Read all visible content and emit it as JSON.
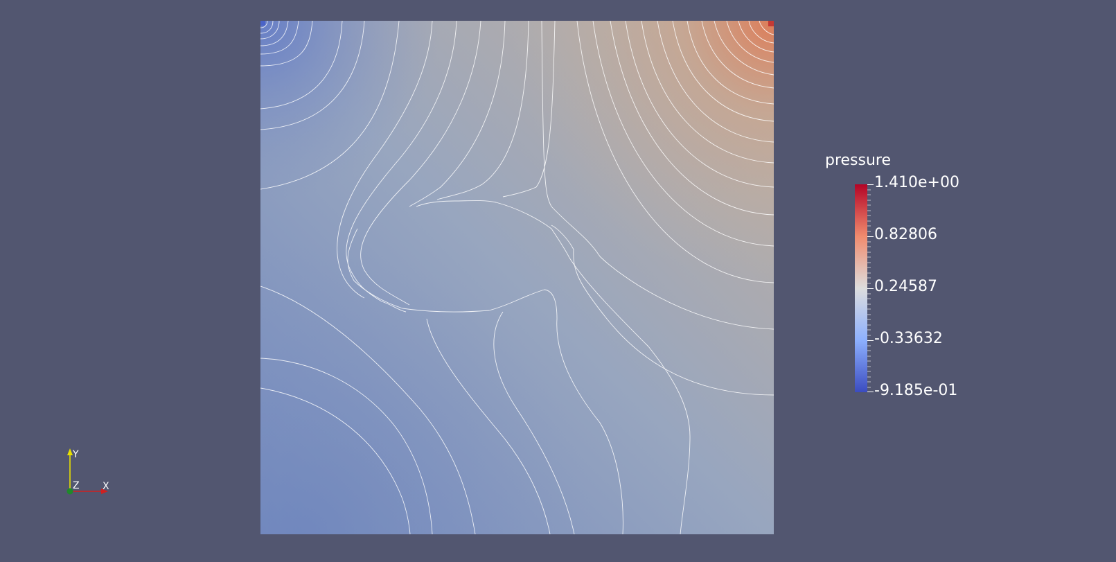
{
  "scalar_bar": {
    "title": "pressure",
    "labels": [
      "1.410e+00",
      "0.82806",
      "0.24587",
      "-0.33632",
      "-9.185e-01"
    ],
    "range": [
      -0.9185,
      1.41
    ],
    "colormap": "Cool to Warm",
    "colors": {
      "min": "#3b4cc0",
      "mid": "#dddddd",
      "max": "#b40426"
    }
  },
  "view": {
    "background_color": "#525670",
    "contour_line_color": "#ffffff",
    "field": "pressure"
  },
  "orientation_axes": {
    "x_label": "X",
    "y_label": "Y",
    "z_label": "Z"
  }
}
